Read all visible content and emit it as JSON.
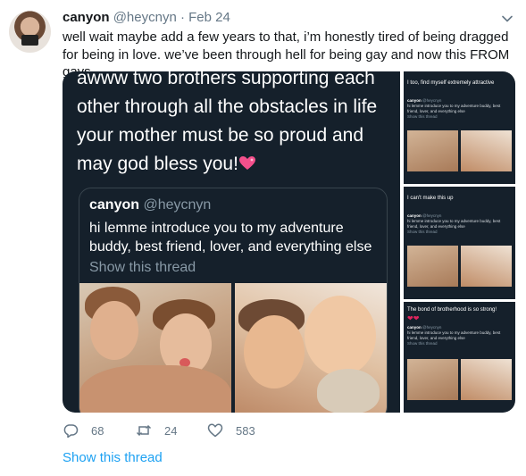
{
  "tweet": {
    "author_name": "canyon",
    "author_handle": "@heycnyn",
    "separator": "·",
    "date": "Feb 24",
    "text": "well wait maybe add a few years to that, i’m honestly tired of being dragged for being in love. we’ve been through hell for being gay and now this FROM gays.",
    "show_thread": "Show this thread"
  },
  "media": {
    "overlay_lines": [
      "awww two brothers supporting each",
      "other through all the obstacles in life",
      "your mother must be so proud and",
      "may god bless you!"
    ],
    "quote": {
      "name": "canyon",
      "handle": "@heycnyn",
      "text": "hi lemme introduce you to my adventure buddy, best friend, lover, and everything else",
      "show_thread": "Show this thread"
    },
    "panels": [
      {
        "caption": "I too, find myself extremely attractive",
        "quote_name": "canyon",
        "quote_handle": "@heycnyn",
        "quote_text": "hi lemme introduce you to my adventure buddy, best friend, lover, and everything else",
        "show": "Show this thread"
      },
      {
        "caption": "I can't make this up",
        "quote_name": "canyon",
        "quote_handle": "@heycnyn",
        "quote_text": "hi lemme introduce you to my adventure buddy, best friend, lover, and everything else",
        "show": "Show this thread"
      },
      {
        "caption": "The bond of brotherhood is so strong!",
        "quote_name": "canyon",
        "quote_handle": "@heycnyn",
        "quote_text": "hi lemme introduce you to my adventure buddy, best friend, lover, and everything else",
        "show": "Show this thread"
      }
    ]
  },
  "actions": {
    "reply_count": "68",
    "retweet_count": "24",
    "like_count": "583"
  },
  "colors": {
    "link": "#1da1f2",
    "muted": "#657786",
    "dark_bg": "#15202b",
    "heart": "#e0245e"
  },
  "icons": [
    "reply-icon",
    "retweet-icon",
    "like-icon",
    "chevron-down-icon",
    "sparkling-heart-icon"
  ]
}
